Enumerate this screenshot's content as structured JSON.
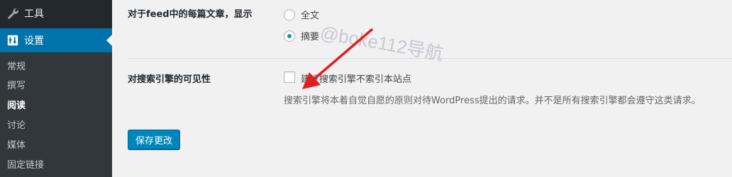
{
  "sidebar": {
    "tools_label": "工具",
    "settings_label": "设置",
    "submenu": [
      "常规",
      "撰写",
      "阅读",
      "讨论",
      "媒体",
      "固定链接"
    ]
  },
  "feed": {
    "label": "对于feed中的每篇文章，显示",
    "options": [
      "全文",
      "摘要"
    ],
    "selected": "摘要"
  },
  "visibility": {
    "label": "对搜索引擎的可见性",
    "checkbox_label": "建议搜索引擎不索引本站点",
    "checked": false,
    "description": "搜索引擎将本着自觉自愿的原则对待WordPress提出的请求。并不是所有搜索引擎都会遵守这类请求。"
  },
  "save_button": "保存更改",
  "watermark": "@boke112导航",
  "colors": {
    "sidebar_bg": "#23282d",
    "active_bg": "#0073aa",
    "button_bg": "#0085ba",
    "arrow_red": "#e02020"
  }
}
